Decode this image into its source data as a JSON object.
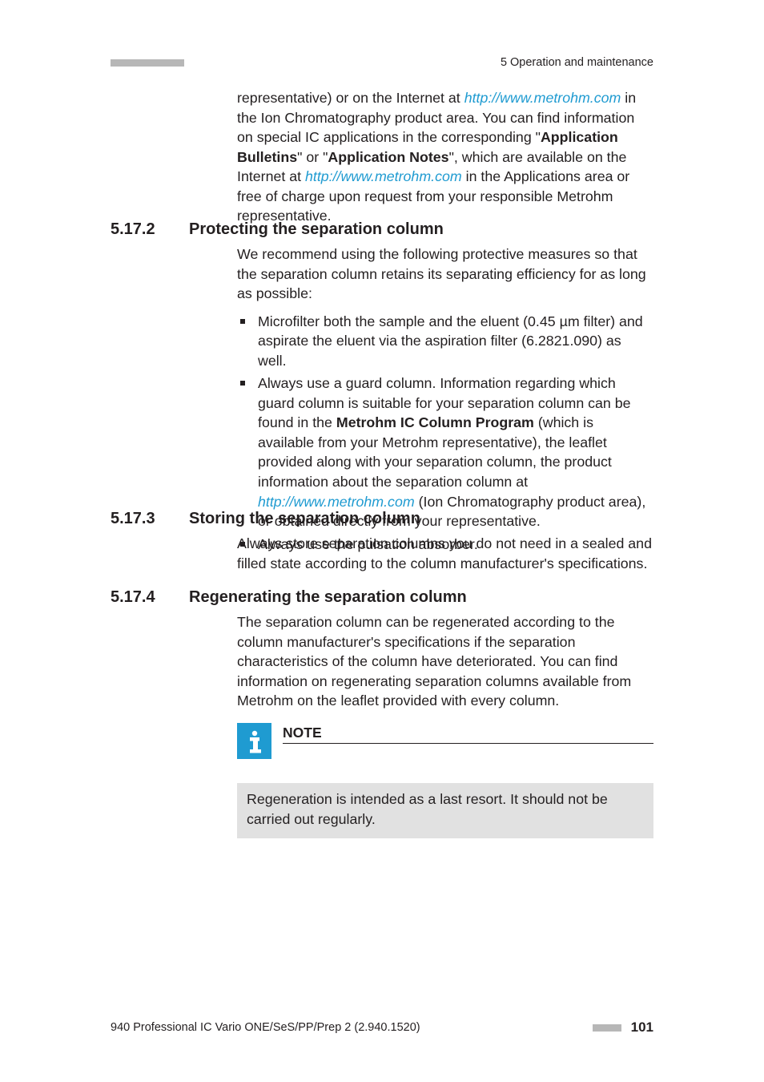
{
  "header": {
    "right": "5 Operation and maintenance"
  },
  "intro": {
    "t1a": "representative) or on the Internet at ",
    "link1": "http://www.metrohm.com",
    "t1b": " in the Ion Chromatography product area. You can find information on special IC applications in the corresponding \"",
    "b1": "Application Bulletins",
    "t1c": "\" or \"",
    "b2": "Application Notes",
    "t1d": "\", which are available on the Internet at ",
    "link2": "http://www.metrohm.com",
    "t1e": " in the Applications area or free of charge upon request from your responsible Metrohm representative."
  },
  "s5172": {
    "num": "5.17.2",
    "title": "Protecting the separation column",
    "p1": "We recommend using the following protective measures so that the separation column retains its separating efficiency for as long as possible:",
    "li1": "Microfilter both the sample and the eluent (0.45 µm filter) and aspirate the eluent via the aspiration filter (6.2821.090) as well.",
    "li2a": "Always use a guard column. Information regarding which guard column is suitable for your separation column can be found in the ",
    "li2b": "Metrohm IC Column Program",
    "li2c": " (which is available from your Metrohm representative), the leaflet provided along with your separation column, the product information about the separation column at ",
    "li2link": "http://www.metrohm.com",
    "li2d": " (Ion Chromatography product area), or obtained directly from your representative.",
    "li3": "Always use the pulsation absorber."
  },
  "s5173": {
    "num": "5.17.3",
    "title": "Storing the separation column",
    "p1": "Always store separation columns you do not need in a sealed and filled state according to the column manufacturer's specifications."
  },
  "s5174": {
    "num": "5.17.4",
    "title": "Regenerating the separation column",
    "p1": "The separation column can be regenerated according to the column manufacturer's specifications if the separation characteristics of the column have deteriorated. You can find information on regenerating separation columns available from Metrohm on the leaflet provided with every column."
  },
  "note": {
    "title": "NOTE",
    "body": "Regeneration is intended as a last resort. It should not be carried out regularly."
  },
  "footer": {
    "left": "940 Professional IC Vario ONE/SeS/PP/Prep 2 (2.940.1520)",
    "page": "101"
  }
}
